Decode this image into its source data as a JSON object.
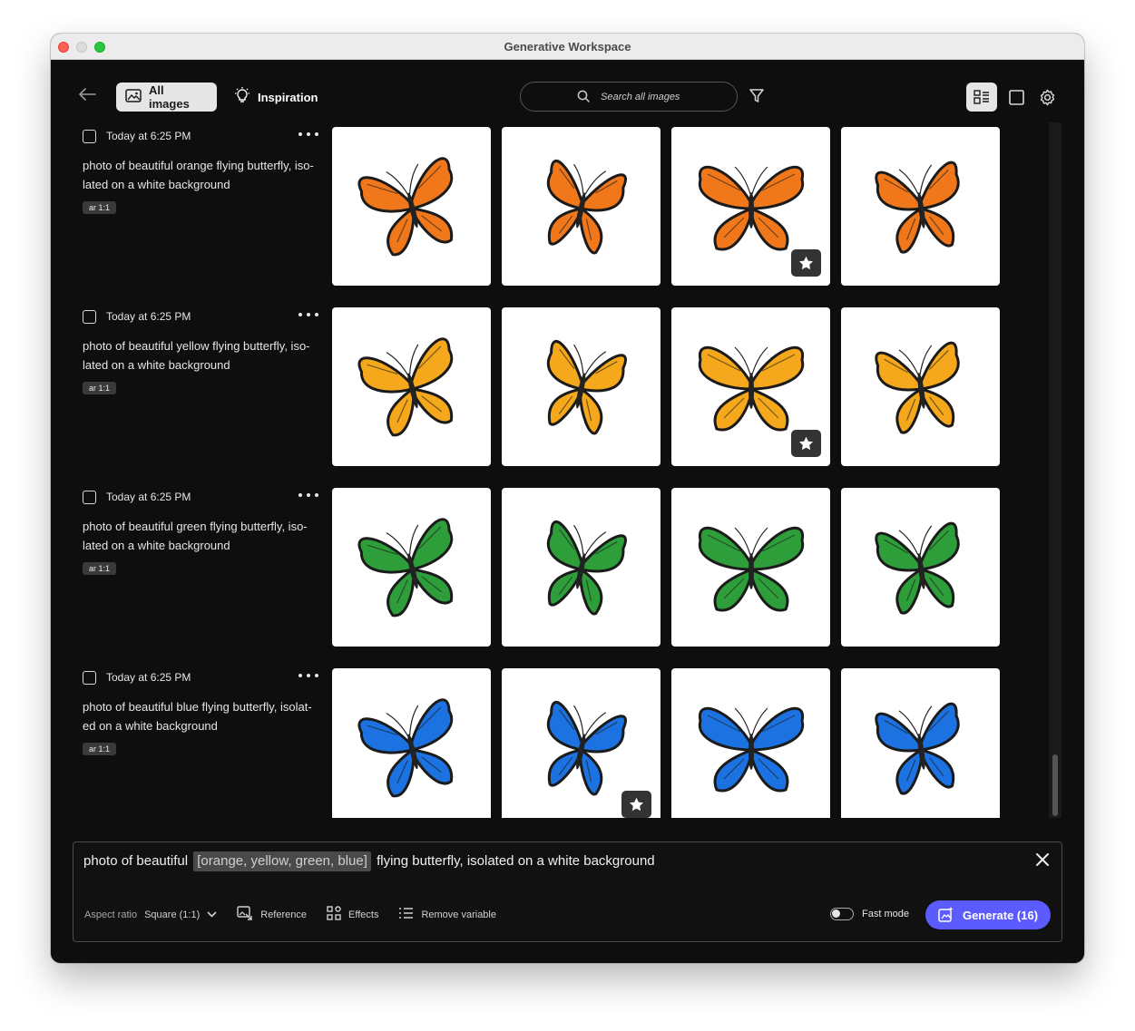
{
  "window": {
    "title": "Generative Workspace"
  },
  "toolbar": {
    "all_images_label": "All images",
    "inspiration_label": "Inspiration",
    "search_placeholder": "Search all images"
  },
  "groups": [
    {
      "time": "Today at 6:25 PM",
      "prompt": "photo of beautiful orange flying butterfly, iso-lated on a white background",
      "aspect": "ar 1:1",
      "color": "#f0781a",
      "favorites": [
        false,
        false,
        true,
        false
      ]
    },
    {
      "time": "Today at 6:25 PM",
      "prompt": "photo of beautiful yellow flying butterfly, iso-lated on a white background",
      "aspect": "ar 1:1",
      "color": "#f5a81c",
      "favorites": [
        false,
        false,
        true,
        false
      ]
    },
    {
      "time": "Today at 6:25 PM",
      "prompt": "photo of beautiful green flying butterfly, iso-lated on a white background",
      "aspect": "ar 1:1",
      "color": "#2e9e3a",
      "favorites": [
        false,
        false,
        false,
        false
      ]
    },
    {
      "time": "Today at 6:25 PM",
      "prompt": "photo of beautiful blue flying butterfly, isolat-ed on a white background",
      "aspect": "ar 1:1",
      "color": "#1b72e0",
      "favorites": [
        false,
        true,
        false,
        false
      ]
    }
  ],
  "composer": {
    "prefix": "photo of beautiful",
    "variable": "[orange, yellow, green, blue]",
    "suffix": "flying butterfly, isolated on a white background",
    "aspect_label": "Aspect ratio",
    "aspect_value": "Square (1:1)",
    "reference_label": "Reference",
    "effects_label": "Effects",
    "remove_variable_label": "Remove variable",
    "fast_mode_label": "Fast mode",
    "generate_label": "Generate (16)"
  }
}
